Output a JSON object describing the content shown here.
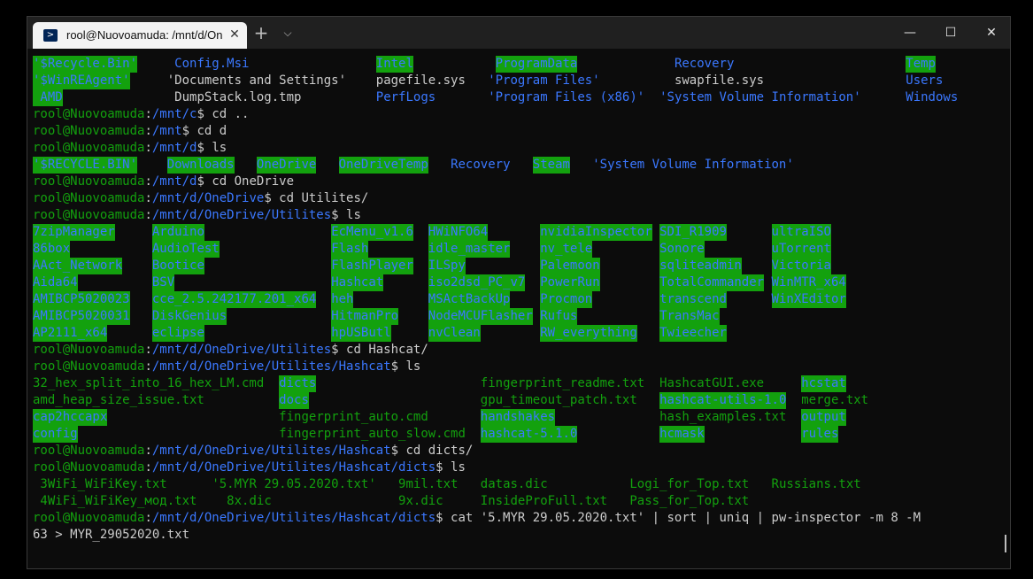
{
  "tab": {
    "title": "rool@Nuovoamuda: /mnt/d/On",
    "close": "✕",
    "icon": "powershell-icon"
  },
  "titlebar": {
    "new_tab": "+",
    "dropdown": "⌵",
    "minimize": "—",
    "maximize": "☐",
    "close": "✕"
  },
  "terminal": {
    "lines": [
      [
        {
          "t": "'$Recycle.Bin'",
          "s": "g",
          "c": 0
        },
        {
          "t": "Config.Msi",
          "s": "b",
          "c": 19
        },
        {
          "t": "Intel",
          "s": "g",
          "c": 46
        },
        {
          "t": "ProgramData",
          "s": "g",
          "c": 62
        },
        {
          "t": "Recovery",
          "s": "b",
          "c": 86
        },
        {
          "t": "Temp",
          "s": "g",
          "c": 117
        }
      ],
      [
        {
          "t": "'$WinREAgent'",
          "s": "g",
          "c": 0
        },
        {
          "t": "'Documents and Settings'",
          "s": "w",
          "c": 18
        },
        {
          "t": "pagefile.sys",
          "s": "w",
          "c": 46
        },
        {
          "t": "'Program Files'",
          "s": "b",
          "c": 61
        },
        {
          "t": "swapfile.sys",
          "s": "w",
          "c": 86
        },
        {
          "t": "Users",
          "s": "b",
          "c": 117
        }
      ],
      [
        {
          "t": " AMD",
          "s": "g",
          "c": 0
        },
        {
          "t": "DumpStack.log.tmp",
          "s": "w",
          "c": 19
        },
        {
          "t": "PerfLogs",
          "s": "b",
          "c": 46
        },
        {
          "t": "'Program Files (x86)'",
          "s": "b",
          "c": 61
        },
        {
          "t": "'System Volume Information'",
          "s": "b",
          "c": 84
        },
        {
          "t": "Windows",
          "s": "b",
          "c": 117
        }
      ],
      {
        "prompt": [
          "rool@Nuovoamuda",
          ":",
          "/mnt/c",
          "$ "
        ],
        "cmd": "cd .."
      },
      {
        "prompt": [
          "rool@Nuovoamuda",
          ":",
          "/mnt",
          "$ "
        ],
        "cmd": "cd d"
      },
      {
        "prompt": [
          "rool@Nuovoamuda",
          ":",
          "/mnt/d",
          "$ "
        ],
        "cmd": "ls"
      },
      [
        {
          "t": "'$RECYCLE.BIN'",
          "s": "g",
          "c": 0
        },
        {
          "t": "Downloads",
          "s": "g",
          "c": 18
        },
        {
          "t": "OneDrive",
          "s": "g",
          "c": 30
        },
        {
          "t": "OneDriveTemp",
          "s": "g",
          "c": 41
        },
        {
          "t": "Recovery",
          "s": "b",
          "c": 56
        },
        {
          "t": "Steam",
          "s": "g",
          "c": 67
        },
        {
          "t": "'System Volume Information'",
          "s": "b",
          "c": 75
        }
      ],
      {
        "prompt": [
          "rool@Nuovoamuda",
          ":",
          "/mnt/d",
          "$ "
        ],
        "cmd": "cd OneDrive"
      },
      {
        "prompt": [
          "rool@Nuovoamuda",
          ":",
          "/mnt/d/OneDrive",
          "$ "
        ],
        "cmd": "cd Utilites/"
      },
      {
        "prompt": [
          "rool@Nuovoamuda",
          ":",
          "/mnt/d/OneDrive/Utilites",
          "$ "
        ],
        "cmd": "ls"
      },
      [
        {
          "t": "7zipManager",
          "s": "g",
          "c": 0
        },
        {
          "t": "Arduino",
          "s": "g",
          "c": 16
        },
        {
          "t": "EcMenu_v1.6",
          "s": "g",
          "c": 40
        },
        {
          "t": "HWiNFO64",
          "s": "g",
          "c": 53
        },
        {
          "t": "nvidiaInspector",
          "s": "g",
          "c": 68
        },
        {
          "t": "SDI_R1909",
          "s": "g",
          "c": 84
        },
        {
          "t": "ultraISO",
          "s": "g",
          "c": 99
        }
      ],
      [
        {
          "t": "86box",
          "s": "g",
          "c": 0
        },
        {
          "t": "AudioTest",
          "s": "g",
          "c": 16
        },
        {
          "t": "Flash",
          "s": "g",
          "c": 40
        },
        {
          "t": "idle_master",
          "s": "g",
          "c": 53
        },
        {
          "t": "nv_tele",
          "s": "g",
          "c": 68
        },
        {
          "t": "Sonore",
          "s": "g",
          "c": 84
        },
        {
          "t": "uTorrent",
          "s": "g",
          "c": 99
        }
      ],
      [
        {
          "t": "AAct_Network",
          "s": "g",
          "c": 0
        },
        {
          "t": "Bootice",
          "s": "g",
          "c": 16
        },
        {
          "t": "FlashPlayer",
          "s": "g",
          "c": 40
        },
        {
          "t": "ILSpy",
          "s": "g",
          "c": 53
        },
        {
          "t": "Palemoon",
          "s": "g",
          "c": 68
        },
        {
          "t": "sqliteadmin",
          "s": "g",
          "c": 84
        },
        {
          "t": "Victoria",
          "s": "g",
          "c": 99
        }
      ],
      [
        {
          "t": "Aida64",
          "s": "g",
          "c": 0
        },
        {
          "t": "BSV",
          "s": "g",
          "c": 16
        },
        {
          "t": "Hashcat",
          "s": "g",
          "c": 40
        },
        {
          "t": "iso2dsd_PC_v7",
          "s": "g",
          "c": 53
        },
        {
          "t": "PowerRun",
          "s": "g",
          "c": 68
        },
        {
          "t": "TotalCommander",
          "s": "g",
          "c": 84
        },
        {
          "t": "WinMTR_x64",
          "s": "g",
          "c": 99
        }
      ],
      [
        {
          "t": "AMIBCP5020023",
          "s": "g",
          "c": 0
        },
        {
          "t": "cce_2.5.242177.201_x64",
          "s": "g",
          "c": 16
        },
        {
          "t": "heh",
          "s": "g",
          "c": 40
        },
        {
          "t": "MSActBackUp",
          "s": "g",
          "c": 53
        },
        {
          "t": "Procmon",
          "s": "g",
          "c": 68
        },
        {
          "t": "transcend",
          "s": "g",
          "c": 84
        },
        {
          "t": "WinXEditor",
          "s": "g",
          "c": 99
        }
      ],
      [
        {
          "t": "AMIBCP5020031",
          "s": "g",
          "c": 0
        },
        {
          "t": "DiskGenius",
          "s": "g",
          "c": 16
        },
        {
          "t": "HitmanPro",
          "s": "g",
          "c": 40
        },
        {
          "t": "NodeMCUFlasher",
          "s": "g",
          "c": 53
        },
        {
          "t": "Rufus",
          "s": "g",
          "c": 68
        },
        {
          "t": "TransMac",
          "s": "g",
          "c": 84
        }
      ],
      [
        {
          "t": "AP2111_x64",
          "s": "g",
          "c": 0
        },
        {
          "t": "eclipse",
          "s": "g",
          "c": 16
        },
        {
          "t": "hpUSButl",
          "s": "g",
          "c": 40
        },
        {
          "t": "nvClean",
          "s": "g",
          "c": 53
        },
        {
          "t": "RW_everything",
          "s": "g",
          "c": 68
        },
        {
          "t": "Twieecher",
          "s": "g",
          "c": 84
        }
      ],
      {
        "prompt": [
          "rool@Nuovoamuda",
          ":",
          "/mnt/d/OneDrive/Utilites",
          "$ "
        ],
        "cmd": "cd Hashcat/"
      },
      {
        "prompt": [
          "rool@Nuovoamuda",
          ":",
          "/mnt/d/OneDrive/Utilites/Hashcat",
          "$ "
        ],
        "cmd": "ls"
      },
      [
        {
          "t": "32_hex_split_into_16_hex_LM.cmd",
          "s": "pu",
          "c": 0
        },
        {
          "t": "dicts",
          "s": "g",
          "c": 33
        },
        {
          "t": "fingerprint_readme.txt",
          "s": "pu",
          "c": 60
        },
        {
          "t": "HashcatGUI.exe",
          "s": "pu",
          "c": 84
        },
        {
          "t": "hcstat",
          "s": "g",
          "c": 103
        }
      ],
      [
        {
          "t": "amd_heap_size_issue.txt",
          "s": "pu",
          "c": 0
        },
        {
          "t": "docs",
          "s": "g",
          "c": 33
        },
        {
          "t": "gpu_timeout_patch.txt",
          "s": "pu",
          "c": 60
        },
        {
          "t": "hashcat-utils-1.0",
          "s": "g",
          "c": 84
        },
        {
          "t": "merge.txt",
          "s": "pu",
          "c": 103
        }
      ],
      [
        {
          "t": "cap2hccapx",
          "s": "g",
          "c": 0
        },
        {
          "t": "fingerprint_auto.cmd",
          "s": "pu",
          "c": 33
        },
        {
          "t": "handshakes",
          "s": "g",
          "c": 60
        },
        {
          "t": "hash_examples.txt",
          "s": "pu",
          "c": 84
        },
        {
          "t": "output",
          "s": "g",
          "c": 103
        }
      ],
      [
        {
          "t": "config",
          "s": "g",
          "c": 0
        },
        {
          "t": "fingerprint_auto_slow.cmd",
          "s": "pu",
          "c": 33
        },
        {
          "t": "hashcat-5.1.0",
          "s": "g",
          "c": 60
        },
        {
          "t": "hcmask",
          "s": "g",
          "c": 84
        },
        {
          "t": "rules",
          "s": "g",
          "c": 103
        }
      ],
      {
        "prompt": [
          "rool@Nuovoamuda",
          ":",
          "/mnt/d/OneDrive/Utilites/Hashcat",
          "$ "
        ],
        "cmd": "cd dicts/"
      },
      {
        "prompt": [
          "rool@Nuovoamuda",
          ":",
          "/mnt/d/OneDrive/Utilites/Hashcat/dicts",
          "$ "
        ],
        "cmd": "ls"
      },
      [
        {
          "t": " 3WiFi_WiFiKey.txt",
          "s": "pu",
          "c": 0
        },
        {
          "t": "'5.MYR 29.05.2020.txt'",
          "s": "pu",
          "c": 24
        },
        {
          "t": "9mil.txt",
          "s": "pu",
          "c": 49
        },
        {
          "t": "datas.dic",
          "s": "pu",
          "c": 60
        },
        {
          "t": "Logi_for_Top.txt",
          "s": "pu",
          "c": 80
        },
        {
          "t": "Russians.txt",
          "s": "pu",
          "c": 99
        }
      ],
      [
        {
          "t": " 4WiFi_WiFiKey_мод.txt",
          "s": "pu",
          "c": 0
        },
        {
          "t": "8x.dic",
          "s": "pu",
          "c": 26
        },
        {
          "t": "9x.dic",
          "s": "pu",
          "c": 49
        },
        {
          "t": "InsideProFull.txt",
          "s": "pu",
          "c": 60
        },
        {
          "t": "Pass_for_Top.txt",
          "s": "pu",
          "c": 80
        }
      ],
      {
        "prompt": [
          "rool@Nuovoamuda",
          ":",
          "/mnt/d/OneDrive/Utilites/Hashcat/dicts",
          "$ "
        ],
        "cmd": "cat '5.MYR 29.05.2020.txt' | sort | uniq | pw-inspector -m 8 -M"
      },
      [
        {
          "t": "63 > MYR_29052020.txt",
          "s": "w",
          "c": 0
        }
      ]
    ]
  }
}
